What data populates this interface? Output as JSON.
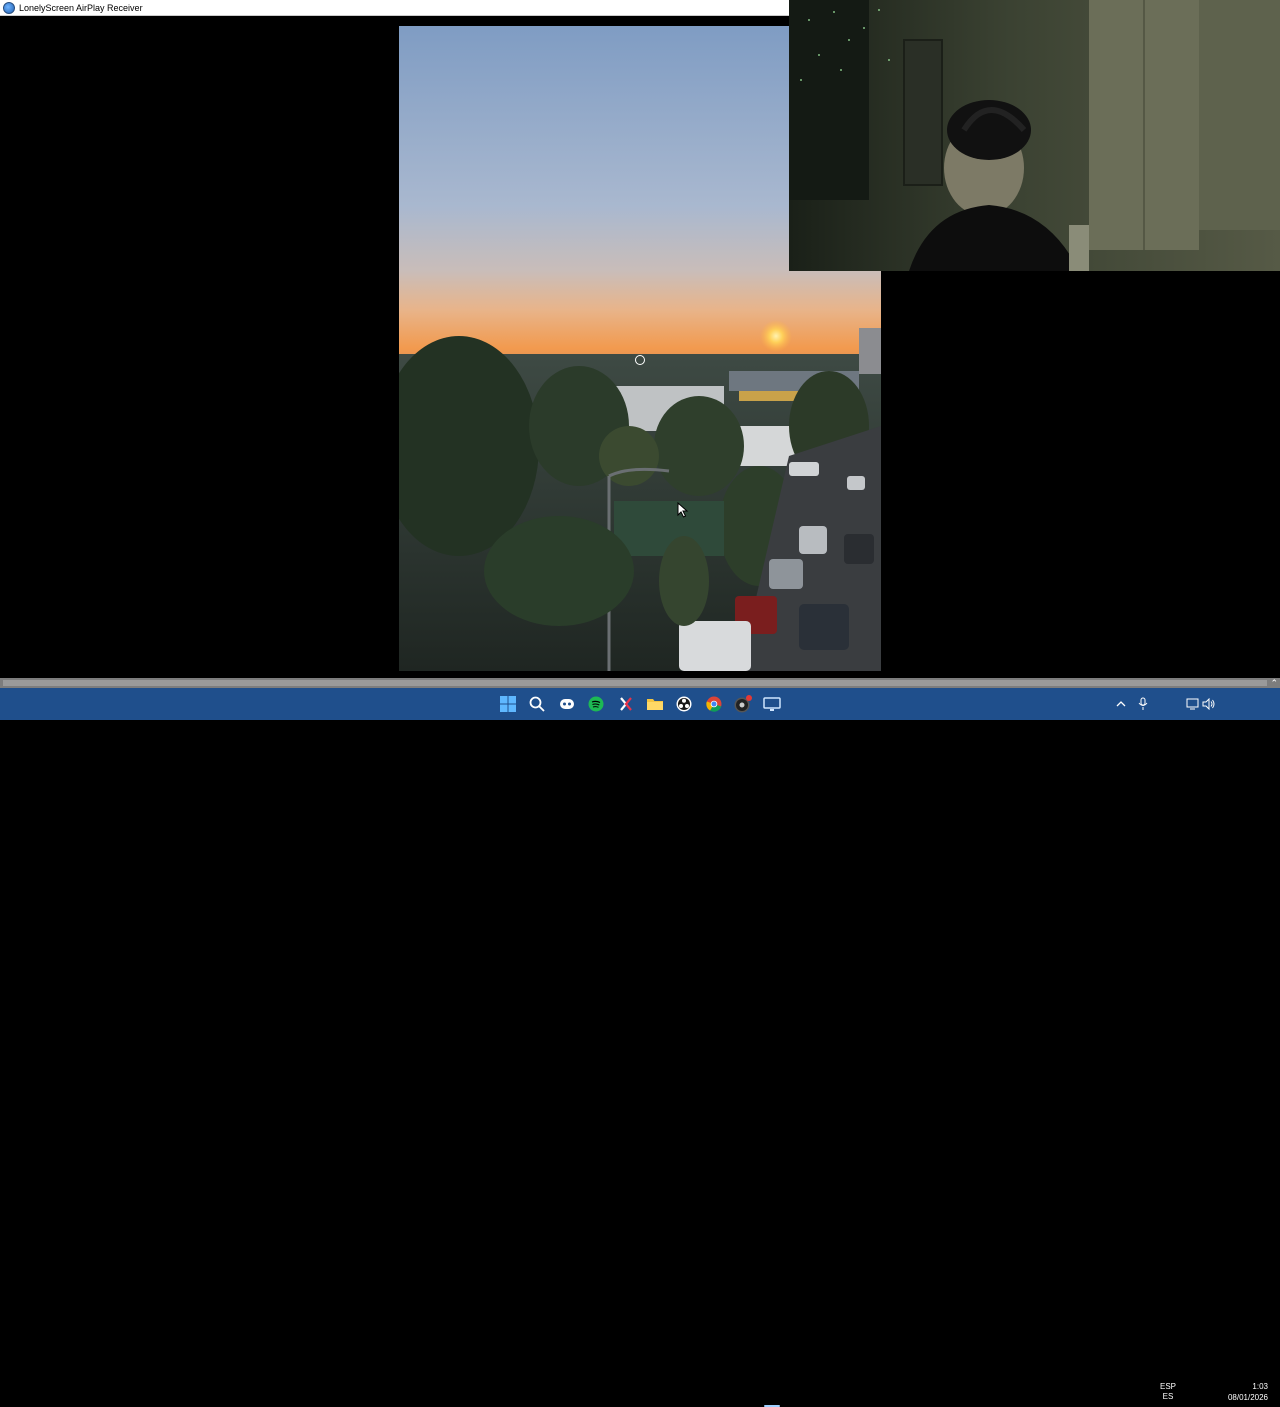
{
  "window": {
    "title": "LonelyScreen AirPlay Receiver",
    "icon": "lonelyscreen-app-icon"
  },
  "content": {
    "mirrored_photo": "sunset-cityscape-photo",
    "webcam_overlay": "webcam-feed"
  },
  "taskbar": {
    "pinned": [
      {
        "name": "windows-start-icon"
      },
      {
        "name": "search-icon"
      },
      {
        "name": "discord-icon"
      },
      {
        "name": "spotify-icon"
      },
      {
        "name": "capcut-icon"
      },
      {
        "name": "file-explorer-icon"
      },
      {
        "name": "obs-icon"
      },
      {
        "name": "chrome-icon"
      },
      {
        "name": "chrome-notification-icon"
      },
      {
        "name": "lonelyscreen-taskbar-icon"
      }
    ],
    "tray": {
      "language_top": "ESP",
      "language_bottom": "ES",
      "time": "1:03",
      "date": "08/01/2026"
    }
  },
  "colors": {
    "taskbar": "#1f4f8c",
    "accent": "#9fd0ff"
  }
}
